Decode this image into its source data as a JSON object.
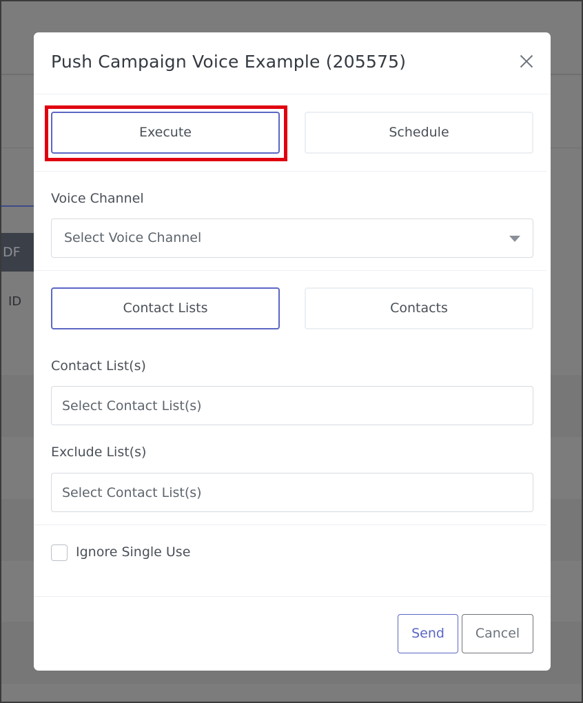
{
  "background": {
    "pdf_label": "DF",
    "id_label": "ID"
  },
  "modal": {
    "title": "Push Campaign Voice Example (205575)",
    "mode_buttons": [
      {
        "label": "Execute",
        "active": true
      },
      {
        "label": "Schedule",
        "active": false
      }
    ],
    "voice_channel": {
      "label": "Voice Channel",
      "placeholder": "Select Voice Channel"
    },
    "recipient_buttons": [
      {
        "label": "Contact Lists",
        "active": true
      },
      {
        "label": "Contacts",
        "active": false
      }
    ],
    "contact_lists": {
      "label": "Contact List(s)",
      "placeholder": "Select Contact List(s)"
    },
    "exclude_lists": {
      "label": "Exclude List(s)",
      "placeholder": "Select Contact List(s)"
    },
    "ignore_single_use": {
      "label": "Ignore Single Use",
      "checked": false
    },
    "footer": {
      "send_label": "Send",
      "cancel_label": "Cancel"
    }
  },
  "colors": {
    "accent": "#5b66c4",
    "highlight": "#e0000f",
    "overlay": "#7c7c7c"
  }
}
